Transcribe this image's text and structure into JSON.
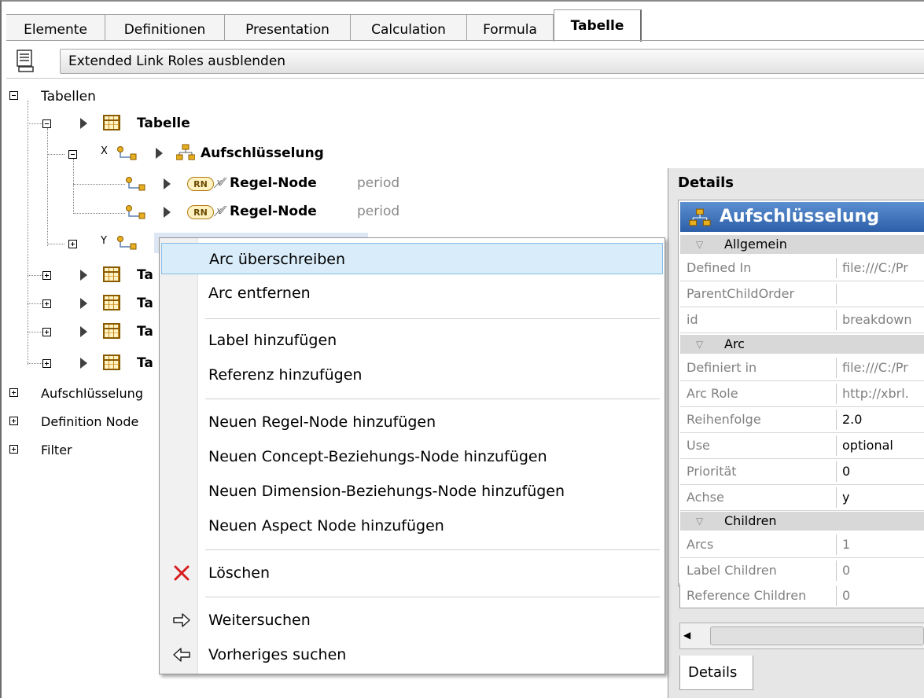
{
  "tabs": [
    "Elemente",
    "Definitionen",
    "Presentation",
    "Calculation",
    "Formula",
    "Tabelle"
  ],
  "active_tab": "Tabelle",
  "toolbar": {
    "button_label": "Extended Link Roles ausblenden"
  },
  "tree": {
    "root": "Tabellen",
    "table_label": "Tabelle",
    "breakdown_label": "Aufschlüsselung",
    "axis_x": "X",
    "axis_y": "Y",
    "rule_node_badge": "RN",
    "rule_node_label": "Regel-Node",
    "rule_node_suffix": "period",
    "collapsed_table_prefix": "Ta",
    "sections": [
      "Aufschlüsselung",
      "Definition Node",
      "Filter"
    ]
  },
  "context_menu": {
    "items": [
      "Arc überschreiben",
      "Arc entfernen",
      "Label hinzufügen",
      "Referenz hinzufügen",
      "Neuen Regel-Node hinzufügen",
      "Neuen Concept-Beziehungs-Node hinzufügen",
      "Neuen Dimension-Beziehungs-Node hinzufügen",
      "Neuen Aspect Node hinzufügen",
      "Löschen",
      "Weitersuchen",
      "Vorheriges suchen"
    ],
    "highlighted": "Arc überschreiben"
  },
  "details": {
    "title": "Details",
    "header": "Aufschlüsselung",
    "sections": {
      "allgemein": "Allgemein",
      "arc": "Arc",
      "children": "Children"
    },
    "allgemein_rows": [
      {
        "key": "Defined In",
        "value": "file:///C:/Pr"
      },
      {
        "key": "ParentChildOrder",
        "value": ""
      },
      {
        "key": "id",
        "value": "breakdown"
      }
    ],
    "arc_rows": [
      {
        "key": "Definiert in",
        "value": "file:///C:/Pr"
      },
      {
        "key": "Arc Role",
        "value": "http://xbrl."
      },
      {
        "key": "Reihenfolge",
        "value": "2.0"
      },
      {
        "key": "Use",
        "value": "optional"
      },
      {
        "key": "Priorität",
        "value": "0"
      },
      {
        "key": "Achse",
        "value": "y"
      }
    ],
    "children_rows": [
      {
        "key": "Arcs",
        "value": "1"
      },
      {
        "key": "Label Children",
        "value": "0"
      },
      {
        "key": "Reference Children",
        "value": "0"
      }
    ],
    "bottom_tab": "Details"
  }
}
